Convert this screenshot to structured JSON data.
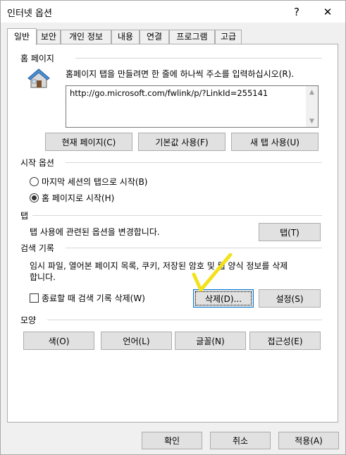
{
  "window": {
    "title": "인터넷 옵션",
    "help_glyph": "?",
    "close_glyph": "✕"
  },
  "tabs": [
    {
      "label": "일반",
      "active": true
    },
    {
      "label": "보안"
    },
    {
      "label": "개인 정보"
    },
    {
      "label": "내용"
    },
    {
      "label": "연결"
    },
    {
      "label": "프로그램"
    },
    {
      "label": "고급"
    }
  ],
  "home": {
    "section_label": "홈 페이지",
    "description": "홈페이지 탭을 만들려면 한 줄에 하나씩 주소를 입력하십시오(R).",
    "url": "http://go.microsoft.com/fwlink/p/?LinkId=255141",
    "buttons": {
      "current": "현재 페이지(C)",
      "default": "기본값 사용(F)",
      "new_tab": "새 탭 사용(U)"
    },
    "icon": "house-icon"
  },
  "startup": {
    "section_label": "시작 옵션",
    "option_last_session": "마지막 세션의 탭으로 시작(B)",
    "option_home": "홈 페이지로 시작(H)",
    "selected": "home"
  },
  "tabs_section": {
    "section_label": "탭",
    "description": "탭 사용에 관련된 옵션을 변경합니다.",
    "button": "탭(T)"
  },
  "history": {
    "section_label": "검색 기록",
    "description_line1": "임시 파일, 열어본 페이지 목록, 쿠키, 저장된 암호 및 웹 양식 정보를 삭제",
    "description_line2": "합니다.",
    "checkbox_label": "종료할 때 검색 기록 삭제(W)",
    "checkbox_checked": false,
    "delete_button": "삭제(D)...",
    "settings_button": "설정(S)"
  },
  "appearance": {
    "section_label": "모양",
    "buttons": {
      "colors": "색(O)",
      "languages": "언어(L)",
      "fonts": "글꼴(N)",
      "accessibility": "접근성(E)"
    }
  },
  "footer": {
    "ok": "확인",
    "cancel": "취소",
    "apply": "적용(A)"
  },
  "colors": {
    "checkmark": "#f2e21a",
    "focus": "#0078d7"
  }
}
